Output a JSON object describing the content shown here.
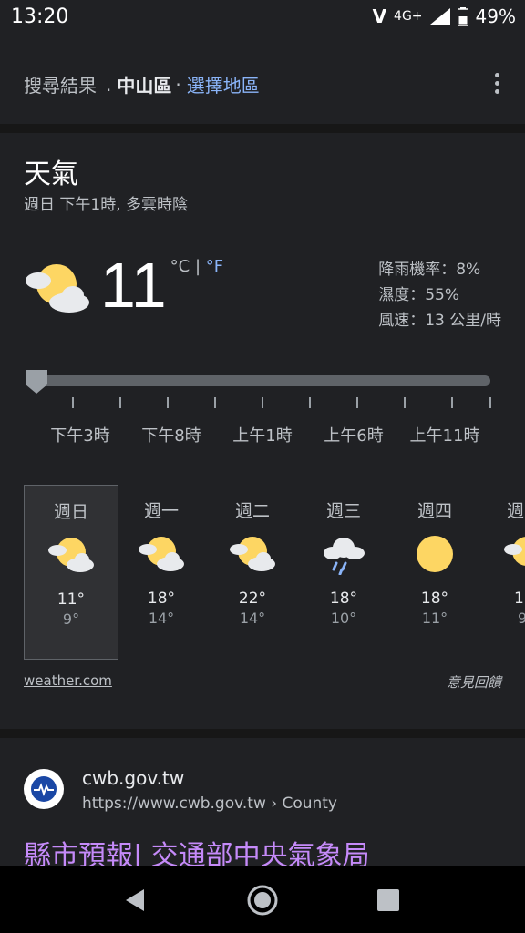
{
  "status_bar": {
    "time": "13:20",
    "network": "4G+",
    "battery": "49%",
    "icons": [
      "volte-icon",
      "signal-icon",
      "battery-icon"
    ]
  },
  "header": {
    "prefix": "搜尋結果",
    "separator1": ".",
    "location": "中山區",
    "separator2": "·",
    "choose_link": "選擇地區"
  },
  "weather": {
    "title": "天氣",
    "subtitle": "週日 下午1時, 多雲時陰",
    "current_temp": "11",
    "unit_c": "°C",
    "unit_sep": "|",
    "unit_f": "°F",
    "precip": "降雨機率：8%",
    "humidity": "濕度：55%",
    "wind": "風速：13 公里/時",
    "slider_value": 0,
    "time_labels": [
      "下午3時",
      "下午8時",
      "上午1時",
      "上午6時",
      "上午11時"
    ],
    "days": [
      {
        "name": "週日",
        "hi": "11°",
        "lo": "9°",
        "icon": "partly-cloudy-icon",
        "selected": true
      },
      {
        "name": "週一",
        "hi": "18°",
        "lo": "14°",
        "icon": "partly-cloudy-icon"
      },
      {
        "name": "週二",
        "hi": "22°",
        "lo": "14°",
        "icon": "partly-cloudy-icon"
      },
      {
        "name": "週三",
        "hi": "18°",
        "lo": "10°",
        "icon": "rain-icon"
      },
      {
        "name": "週四",
        "hi": "18°",
        "lo": "11°",
        "icon": "sunny-icon"
      },
      {
        "name": "週",
        "hi": "1",
        "lo": "9",
        "icon": "partly-cloudy-icon"
      }
    ],
    "source": "weather.com",
    "feedback": "意見回饋"
  },
  "result": {
    "domain": "cwb.gov.tw",
    "url": "https://www.cwb.gov.tw › County",
    "title": "縣市預報| 交通部中央氣象局"
  },
  "colors": {
    "background": "#202124",
    "link_blue": "#8ab4f8",
    "visited_purple": "#c58af9",
    "sun_yellow": "#fdd663"
  }
}
